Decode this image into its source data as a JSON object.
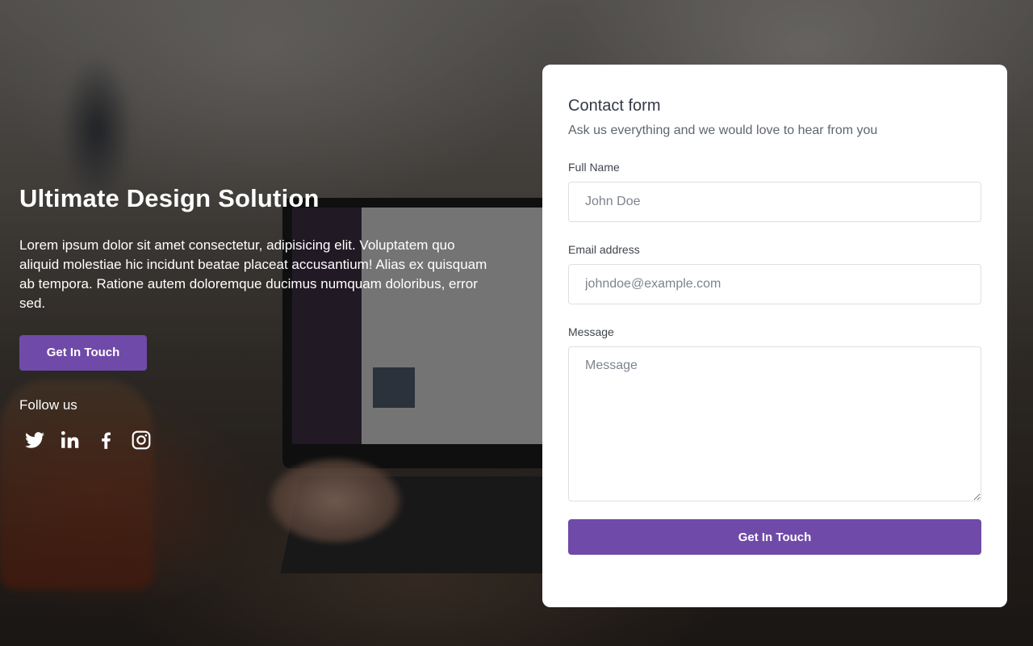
{
  "hero": {
    "title": "Ultimate Design Solution",
    "description": "Lorem ipsum dolor sit amet consectetur, adipisicing elit. Voluptatem quo aliquid molestiae hic incidunt beatae placeat accusantium! Alias ex quisquam ab tempora. Ratione autem doloremque ducimus numquam doloribus, error sed.",
    "cta_label": "Get In Touch",
    "follow_label": "Follow us",
    "socials": [
      "twitter-icon",
      "linkedin-icon",
      "facebook-icon",
      "instagram-icon"
    ]
  },
  "form": {
    "title": "Contact form",
    "subtitle": "Ask us everything and we would love to hear from you",
    "full_name": {
      "label": "Full Name",
      "placeholder": "John Doe",
      "value": ""
    },
    "email": {
      "label": "Email address",
      "placeholder": "johndoe@example.com",
      "value": ""
    },
    "message": {
      "label": "Message",
      "placeholder": "Message",
      "value": ""
    },
    "submit_label": "Get In Touch"
  },
  "colors": {
    "accent": "#6f4aa8",
    "card_bg": "#ffffff",
    "text_dark": "#333a44"
  }
}
